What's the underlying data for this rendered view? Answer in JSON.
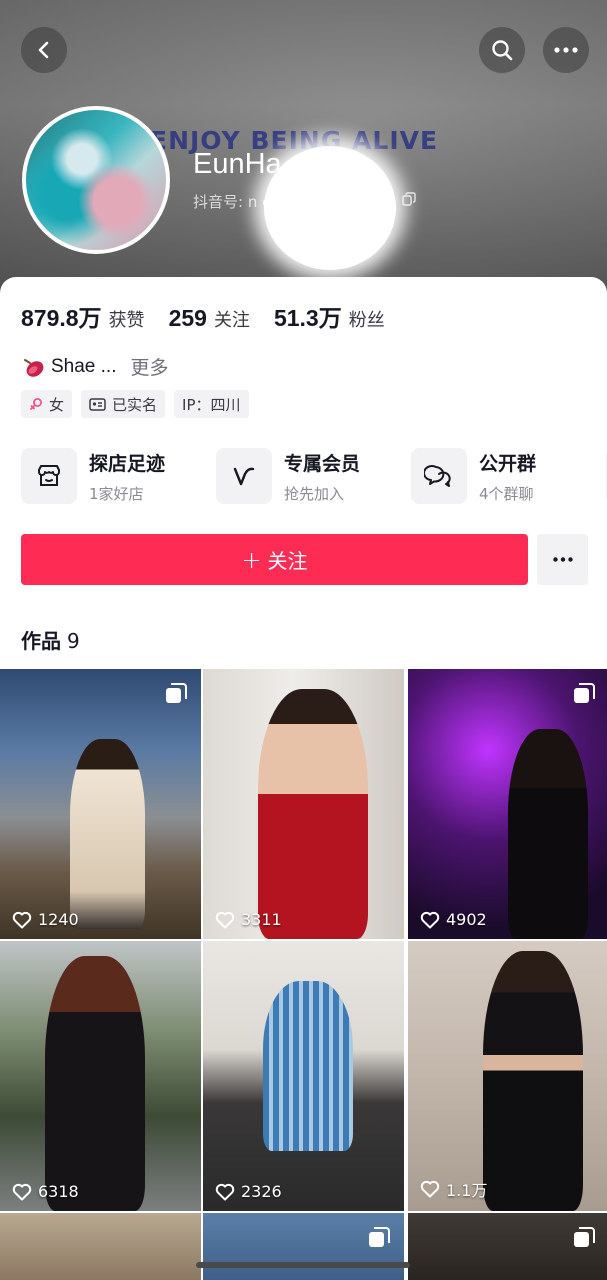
{
  "banner": {
    "slogan": "ENJOY BEING ALIVE"
  },
  "profile": {
    "name": "EunHa",
    "douyin_id": "抖音号: n                    e"
  },
  "stats": [
    {
      "value": "879.8万",
      "label": "获赞"
    },
    {
      "value": "259",
      "label": "关注"
    },
    {
      "value": "51.3万",
      "label": "粉丝"
    }
  ],
  "bio": {
    "text": "Shae ...",
    "more": "更多"
  },
  "tags": [
    {
      "icon": "female-icon",
      "label": "女"
    },
    {
      "icon": "id-card-icon",
      "label": "已实名"
    },
    {
      "icon": "",
      "label": "IP：四川"
    }
  ],
  "services": [
    {
      "icon": "store-icon",
      "title": "探店足迹",
      "sub": "1家好店"
    },
    {
      "icon": "vip-icon",
      "title": "专属会员",
      "sub": "抢先加入"
    },
    {
      "icon": "group-chat-icon",
      "title": "公开群",
      "sub": "4个群聊"
    }
  ],
  "follow": {
    "label": "关注"
  },
  "works": {
    "title": "作品",
    "count": "9"
  },
  "posts": [
    {
      "likes": "1240",
      "multi": true
    },
    {
      "likes": "3311",
      "multi": false
    },
    {
      "likes": "4902",
      "multi": true
    },
    {
      "likes": "6318",
      "multi": false
    },
    {
      "likes": "2326",
      "multi": false
    },
    {
      "likes": "1.1万",
      "multi": false
    },
    {
      "likes": "",
      "multi": false
    },
    {
      "likes": "",
      "multi": true
    },
    {
      "likes": "",
      "multi": true
    }
  ],
  "colors": {
    "accent": "#fe2c55",
    "text": "#161823",
    "muted": "#8a8b93"
  }
}
